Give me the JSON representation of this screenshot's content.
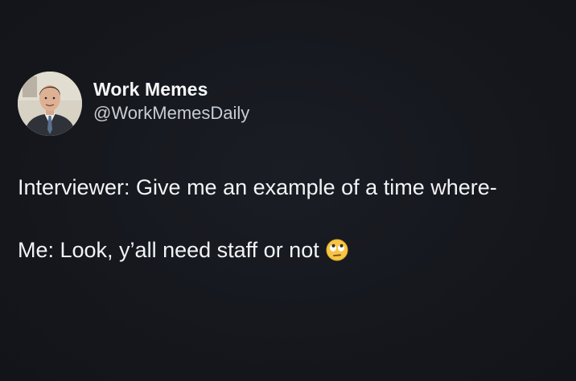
{
  "tweet": {
    "author": {
      "display_name": "Work Memes",
      "handle": "@WorkMemesDaily",
      "avatar_icon": "profile-photo-man-in-suit"
    },
    "lines": [
      "Interviewer: Give me an example of a time where-",
      "Me: Look, y’all need staff or not"
    ],
    "emoji": "eye-roll-emoji"
  },
  "colors": {
    "background": "#15171d",
    "text": "#f2f3f5",
    "handle": "#c9ccd2",
    "emoji": "#f6c544"
  }
}
